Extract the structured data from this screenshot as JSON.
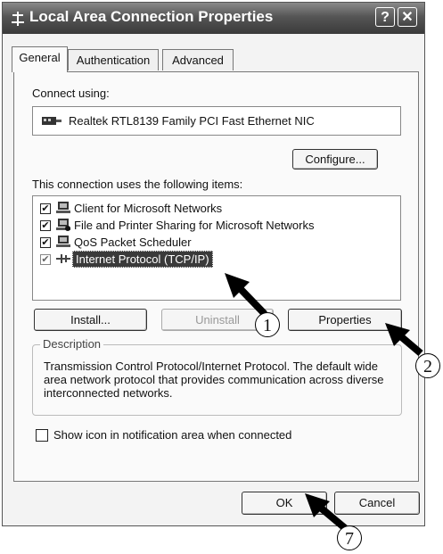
{
  "window": {
    "title": "Local Area Connection Properties",
    "help_button": "?",
    "close_button": "✕"
  },
  "tabs": [
    {
      "label": "General"
    },
    {
      "label": "Authentication"
    },
    {
      "label": "Advanced"
    }
  ],
  "general": {
    "connect_using_label": "Connect using:",
    "adapter_name": "Realtek RTL8139 Family PCI Fast Ethernet NIC",
    "configure_label": "Configure...",
    "items_label": "This connection uses the following items:",
    "items": [
      {
        "label": "Client for Microsoft Networks",
        "checked": true,
        "icon": "network-client-icon"
      },
      {
        "label": "File and Printer Sharing for Microsoft Networks",
        "checked": true,
        "icon": "file-printer-sharing-icon"
      },
      {
        "label": "QoS Packet Scheduler",
        "checked": true,
        "icon": "qos-scheduler-icon"
      },
      {
        "label": "Internet Protocol (TCP/IP)",
        "checked": true,
        "icon": "protocol-icon",
        "selected": true
      }
    ],
    "install_label": "Install...",
    "uninstall_label": "Uninstall",
    "properties_label": "Properties",
    "description_title": "Description",
    "description_text": "Transmission Control Protocol/Internet Protocol. The default wide area network protocol that provides communication across diverse interconnected networks.",
    "show_icon_label": "Show icon in notification area when connected",
    "show_icon_checked": false
  },
  "footer": {
    "ok_label": "OK",
    "cancel_label": "Cancel"
  },
  "callouts": {
    "one": "1",
    "two": "2",
    "seven": "7"
  },
  "colors": {
    "titlebar": "#4a4a4a",
    "selection": "#3a3a3a",
    "panel": "#fafafa"
  }
}
